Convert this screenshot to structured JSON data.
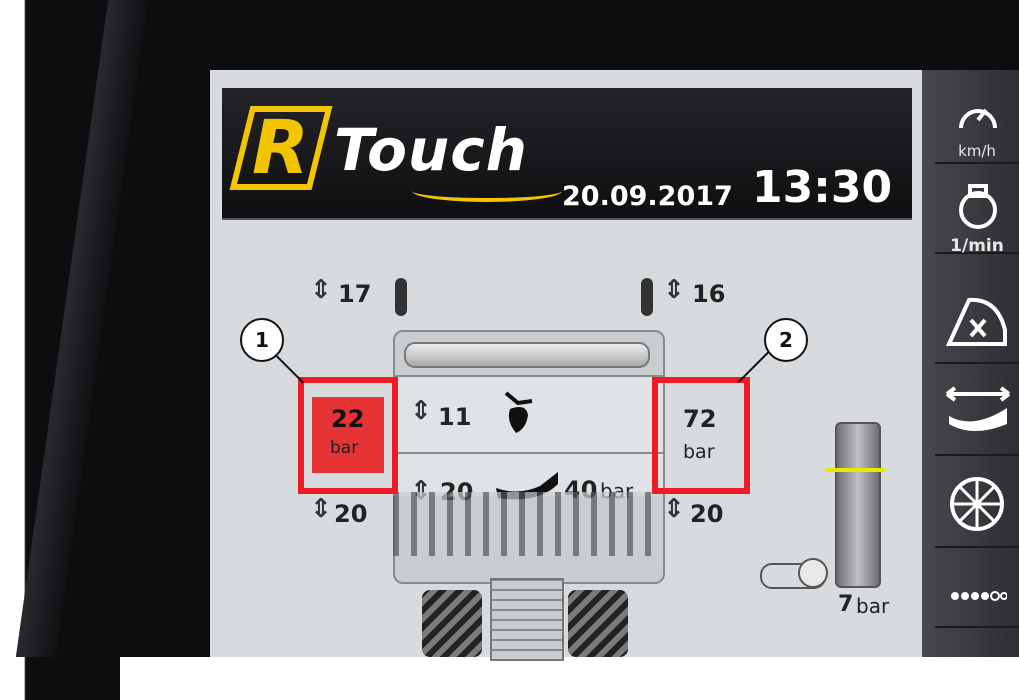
{
  "header": {
    "logo_letter": "R",
    "logo_text": "Touch",
    "date": "20.09.2017",
    "time": "13:30"
  },
  "side_panel": {
    "items": [
      {
        "icon": "speedometer-icon",
        "label": "km/h"
      },
      {
        "icon": "engine-icon",
        "label": "1/min"
      },
      {
        "icon": "header-tilt-icon",
        "label": ""
      },
      {
        "icon": "side-shift-icon",
        "label": ""
      },
      {
        "icon": "wheel-icon",
        "label": ""
      },
      {
        "icon": "chain-icon",
        "label": ""
      }
    ]
  },
  "machine": {
    "left_height": "17",
    "right_height": "16",
    "middle_height": "11",
    "share_height": "20",
    "share_pressure": "40",
    "share_unit": "bar",
    "left_bottom_height": "20",
    "right_bottom_height": "20"
  },
  "pressures": {
    "left": {
      "value": "22",
      "unit": "bar",
      "alarm": true
    },
    "right": {
      "value": "72",
      "unit": "bar",
      "alarm": false
    },
    "gauge": {
      "value": "7",
      "unit": "bar"
    }
  },
  "callouts": {
    "one": "1",
    "two": "2"
  },
  "colors": {
    "logo_yellow": "#f2c500",
    "alarm_red": "#e63333",
    "frame_red": "#ee1b24"
  }
}
